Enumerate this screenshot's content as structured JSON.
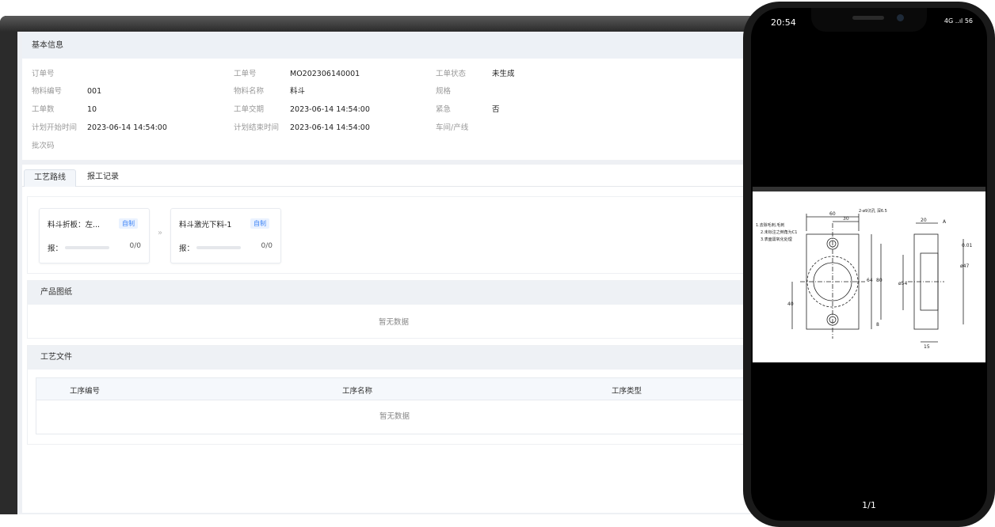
{
  "basic_info": {
    "title": "基本信息",
    "fields": [
      {
        "label": "订单号",
        "value": ""
      },
      {
        "label": "工单号",
        "value": "MO202306140001"
      },
      {
        "label": "工单状态",
        "value": "未生成"
      },
      {
        "label": "物料编号",
        "value": "001"
      },
      {
        "label": "物料名称",
        "value": "料斗"
      },
      {
        "label": "规格",
        "value": ""
      },
      {
        "label": "工单数",
        "value": "10"
      },
      {
        "label": "工单交期",
        "value": "2023-06-14 14:54:00"
      },
      {
        "label": "紧急",
        "value": "否"
      },
      {
        "label": "计划开始时间",
        "value": "2023-06-14 14:54:00"
      },
      {
        "label": "计划结束时间",
        "value": "2023-06-14 14:54:00"
      },
      {
        "label": "车间/产线",
        "value": ""
      },
      {
        "label": "批次码",
        "value": ""
      }
    ]
  },
  "tabs": [
    {
      "label": "工艺路线",
      "active": true
    },
    {
      "label": "报工记录",
      "active": false
    }
  ],
  "route_cards": [
    {
      "title": "料斗折板：左...",
      "tag": "自制",
      "report_label": "报：",
      "count": "0/0"
    },
    {
      "title": "料斗激光下料-1",
      "tag": "自制",
      "report_label": "报：",
      "count": "0/0"
    }
  ],
  "route_arrow": "»",
  "product_drawing": {
    "title": "产品图纸",
    "empty_text": "暂无数据"
  },
  "process_files": {
    "title": "工艺文件",
    "columns": [
      "工序编号",
      "工序名称",
      "工序类型"
    ],
    "empty_text": "暂无数据"
  },
  "phone": {
    "time": "20:54",
    "status": "4G ..ıl 56",
    "page_indicator": "1/1",
    "drawing_notes": [
      "1.去除毛刺,毛刺",
      "2.未标注之倒角为C1",
      "3.表面需氧化处理"
    ],
    "drawing_callout": "2-ø9沉孔 深6.5",
    "drawing_dims": [
      "60",
      "30",
      "20",
      "64",
      "80",
      "40",
      "8",
      "ø54",
      "ø47",
      "15",
      "0.01",
      "A"
    ]
  }
}
